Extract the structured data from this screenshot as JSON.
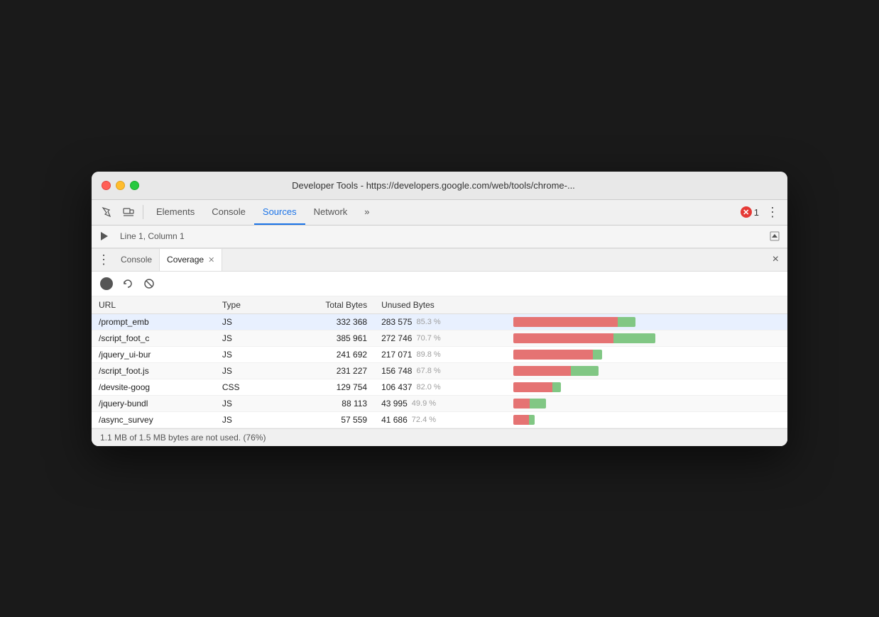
{
  "window": {
    "title": "Developer Tools - https://developers.google.com/web/tools/chrome-..."
  },
  "toolbar": {
    "tabs": [
      {
        "id": "elements",
        "label": "Elements",
        "active": false
      },
      {
        "id": "console",
        "label": "Console",
        "active": false
      },
      {
        "id": "sources",
        "label": "Sources",
        "active": true
      },
      {
        "id": "network",
        "label": "Network",
        "active": false
      },
      {
        "id": "more",
        "label": "»",
        "active": false
      }
    ],
    "error_count": "1",
    "more_label": "⋮"
  },
  "secondary": {
    "status": "Line 1, Column 1"
  },
  "panel": {
    "tabs": [
      {
        "id": "console",
        "label": "Console",
        "active": false
      },
      {
        "id": "coverage",
        "label": "Coverage",
        "active": true
      }
    ],
    "close_label": "×"
  },
  "coverage": {
    "columns": [
      {
        "id": "url",
        "label": "URL"
      },
      {
        "id": "type",
        "label": "Type"
      },
      {
        "id": "total_bytes",
        "label": "Total Bytes"
      },
      {
        "id": "unused_bytes",
        "label": "Unused Bytes"
      },
      {
        "id": "bar",
        "label": ""
      }
    ],
    "rows": [
      {
        "url": "/prompt_emb",
        "type": "JS",
        "total_bytes": "332 368",
        "unused_bytes": "283 575",
        "unused_pct": "85.3 %",
        "red_pct": 85.3,
        "green_pct": 14.7,
        "highlighted": true
      },
      {
        "url": "/script_foot_c",
        "type": "JS",
        "total_bytes": "385 961",
        "unused_bytes": "272 746",
        "unused_pct": "70.7 %",
        "red_pct": 70.7,
        "green_pct": 29.3,
        "highlighted": false
      },
      {
        "url": "/jquery_ui-bur",
        "type": "JS",
        "total_bytes": "241 692",
        "unused_bytes": "217 071",
        "unused_pct": "89.8 %",
        "red_pct": 89.8,
        "green_pct": 10.2,
        "highlighted": false
      },
      {
        "url": "/script_foot.js",
        "type": "JS",
        "total_bytes": "231 227",
        "unused_bytes": "156 748",
        "unused_pct": "67.8 %",
        "red_pct": 67.8,
        "green_pct": 32.2,
        "highlighted": false
      },
      {
        "url": "/devsite-goog",
        "type": "CSS",
        "total_bytes": "129 754",
        "unused_bytes": "106 437",
        "unused_pct": "82.0 %",
        "red_pct": 82.0,
        "green_pct": 18.0,
        "highlighted": false
      },
      {
        "url": "/jquery-bundl",
        "type": "JS",
        "total_bytes": "88 113",
        "unused_bytes": "43 995",
        "unused_pct": "49.9 %",
        "red_pct": 49.9,
        "green_pct": 50.1,
        "highlighted": false
      },
      {
        "url": "/async_survey",
        "type": "JS",
        "total_bytes": "57 559",
        "unused_bytes": "41 686",
        "unused_pct": "72.4 %",
        "red_pct": 72.4,
        "green_pct": 27.6,
        "highlighted": false
      }
    ],
    "status": "1.1 MB of 1.5 MB bytes are not used. (76%)"
  }
}
